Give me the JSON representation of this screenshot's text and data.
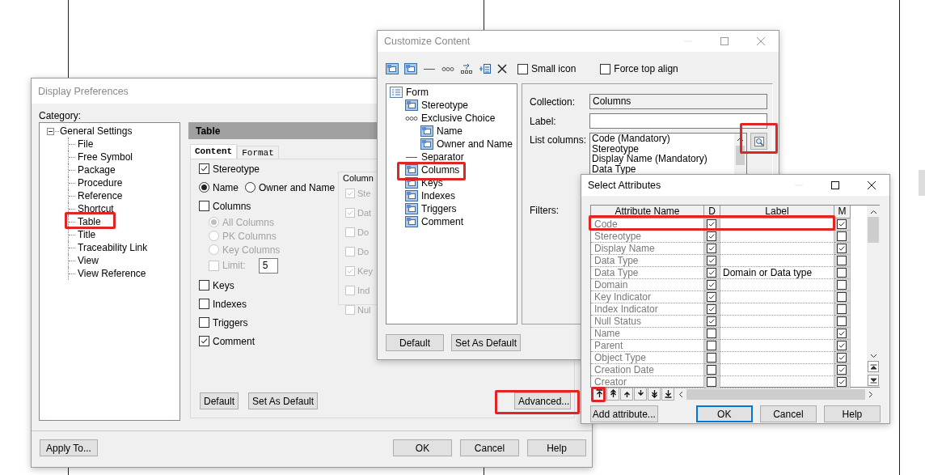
{
  "display_preferences": {
    "title": "Display Preferences",
    "category_label": "Category:",
    "categories": [
      {
        "label": "General Settings",
        "expanded": true,
        "children": [
          {
            "label": "File"
          },
          {
            "label": "Free Symbol"
          },
          {
            "label": "Package"
          },
          {
            "label": "Procedure"
          },
          {
            "label": "Reference"
          },
          {
            "label": "Shortcut"
          },
          {
            "label": "Table"
          },
          {
            "label": "Title"
          },
          {
            "label": "Traceability Link"
          },
          {
            "label": "View"
          },
          {
            "label": "View Reference"
          }
        ]
      }
    ],
    "panel_title": "Table",
    "tabs": [
      {
        "label": "Content",
        "selected": true
      },
      {
        "label": "Format",
        "selected": false
      }
    ],
    "options": [
      {
        "kind": "checkbox",
        "label": "Stereotype",
        "checked": true
      },
      {
        "kind": "radios",
        "choices": [
          {
            "label": "Name",
            "selected": true
          },
          {
            "label": "Owner and Name",
            "selected": false
          }
        ]
      },
      {
        "kind": "checkbox",
        "label": "Columns",
        "checked": false,
        "children": [
          {
            "kind": "radio",
            "label": "All Columns",
            "selected": true,
            "disabled": true
          },
          {
            "kind": "radio",
            "label": "PK Columns",
            "selected": false,
            "disabled": true
          },
          {
            "kind": "radio",
            "label": "Key Columns",
            "selected": false,
            "disabled": true
          },
          {
            "kind": "limit",
            "label": "Limit:",
            "checked": false,
            "disabled": true,
            "value": "5"
          }
        ]
      },
      {
        "kind": "checkbox",
        "label": "Keys",
        "checked": false
      },
      {
        "kind": "checkbox",
        "label": "Indexes",
        "checked": false
      },
      {
        "kind": "checkbox",
        "label": "Triggers",
        "checked": false
      },
      {
        "kind": "checkbox",
        "label": "Comment",
        "checked": true
      }
    ],
    "columns_group": {
      "title": "Column",
      "disabled": true,
      "items": [
        {
          "label": "Ste",
          "checked": true
        },
        {
          "label": "Dat",
          "checked": true
        },
        {
          "label": "Do",
          "checked": false
        },
        {
          "label": "Do",
          "checked": false
        },
        {
          "label": "Key",
          "checked": true
        },
        {
          "label": "Ind",
          "checked": false
        },
        {
          "label": "Nul",
          "checked": false
        }
      ]
    },
    "pane_buttons": [
      "Default",
      "Set As Default"
    ],
    "advanced_button": "Advanced...",
    "apply_button": "Apply To...",
    "buttons": [
      "OK",
      "Cancel",
      "Help"
    ]
  },
  "customize_content": {
    "title": "Customize Content",
    "toolbar_options": [
      {
        "label": "Small icon",
        "checked": false
      },
      {
        "label": "Force top align",
        "checked": false
      }
    ],
    "tree": [
      {
        "label": "Form",
        "kind": "form",
        "children": [
          {
            "label": "Stereotype",
            "kind": "object"
          },
          {
            "label": "Exclusive Choice",
            "kind": "choice",
            "children": [
              {
                "label": "Name",
                "kind": "object"
              },
              {
                "label": "Owner and Name",
                "kind": "object"
              }
            ]
          },
          {
            "label": "Separator",
            "kind": "separator"
          },
          {
            "label": "Columns",
            "kind": "object"
          },
          {
            "label": "Keys",
            "kind": "object"
          },
          {
            "label": "Indexes",
            "kind": "object"
          },
          {
            "label": "Triggers",
            "kind": "object"
          },
          {
            "label": "Comment",
            "kind": "object"
          }
        ]
      }
    ],
    "collection": {
      "label": "Collection:",
      "value": "Columns"
    },
    "label_field": {
      "label": "Label:"
    },
    "list_columns": {
      "label": "List columns:",
      "items": [
        "Code (Mandatory)",
        "Stereotype",
        "Display Name (Mandatory)",
        "Data Type"
      ]
    },
    "filters_label": "Filters:",
    "buttons": [
      "Default",
      "Set As Default"
    ]
  },
  "select_attributes": {
    "title": "Select Attributes",
    "columns": [
      "Attribute Name",
      "D",
      "Label",
      "M"
    ],
    "rows": [
      {
        "name": "Code",
        "d": true,
        "m": true
      },
      {
        "name": "Stereotype",
        "d": true,
        "m": false
      },
      {
        "name": "Display Name",
        "d": true,
        "m": true
      },
      {
        "name": "Data Type",
        "d": true,
        "m": false
      },
      {
        "name": "Data Type",
        "d": true,
        "label": "Domain or Data type",
        "m": false
      },
      {
        "name": "Domain",
        "d": true,
        "m": false
      },
      {
        "name": "Key Indicator",
        "d": true,
        "m": false
      },
      {
        "name": "Index Indicator",
        "d": true,
        "m": false
      },
      {
        "name": "Null Status",
        "d": true,
        "m": false
      },
      {
        "name": "Name",
        "d": false,
        "m": true
      },
      {
        "name": "Parent",
        "d": false,
        "m": true
      },
      {
        "name": "Object Type",
        "d": false,
        "m": true
      },
      {
        "name": "Creation Date",
        "d": false,
        "m": true
      },
      {
        "name": "Creator",
        "d": false,
        "m": true
      }
    ],
    "add_button": "Add attribute...",
    "buttons": [
      {
        "label": "OK",
        "focused": true
      },
      {
        "label": "Cancel",
        "focused": false
      },
      {
        "label": "Help",
        "focused": false
      }
    ]
  }
}
